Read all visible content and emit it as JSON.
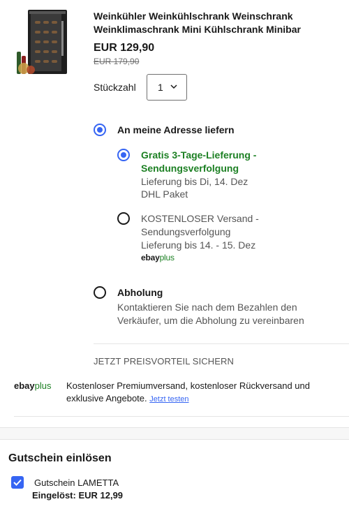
{
  "product": {
    "image_icon": "wine-fridge-image",
    "title": "Weinkühler Weinkühlschrank Weinschrank Weinklimaschrank Mini Kühlschrank Minibar",
    "price": "EUR 129,90",
    "old_price": "EUR 179,90"
  },
  "quantity": {
    "label": "Stückzahl",
    "value": "1"
  },
  "shipping": {
    "home_delivery": {
      "label": "An meine Adresse liefern",
      "selected": true,
      "options": [
        {
          "title_line1": "Gratis 3-Tage-Lieferung -",
          "title_line2": "Sendungsverfolgung",
          "delivery": "Lieferung bis Di, 14. Dez",
          "carrier": "DHL Paket",
          "selected": true
        },
        {
          "title_line1": "KOSTENLOSER Versand -",
          "title_line2": "Sendungsverfolgung",
          "delivery": "Lieferung bis 14. - 15. Dez",
          "badge_ebay": "ebay",
          "badge_plus": "plus",
          "selected": false
        }
      ]
    },
    "pickup": {
      "label": "Abholung",
      "line1": "Kontaktieren Sie nach dem Bezahlen den",
      "line2": "Verkäufer, um die Abholung zu vereinbaren",
      "selected": false
    }
  },
  "promo": {
    "heading": "JETZT PREISVORTEIL SICHERN",
    "logo_ebay": "ebay",
    "logo_plus": "plus",
    "text": "Kostenloser Premiumversand, kostenloser Rückversand und exklusive Angebote.",
    "link": "Jetzt testen"
  },
  "coupon": {
    "heading": "Gutschein einlösen",
    "label": "Gutschein LAMETTA",
    "applied": "Eingelöst: EUR 12,99",
    "checked": true
  },
  "colors": {
    "accent": "#3665f3",
    "green": "#1d8024",
    "text": "#191919",
    "muted": "#555555"
  }
}
